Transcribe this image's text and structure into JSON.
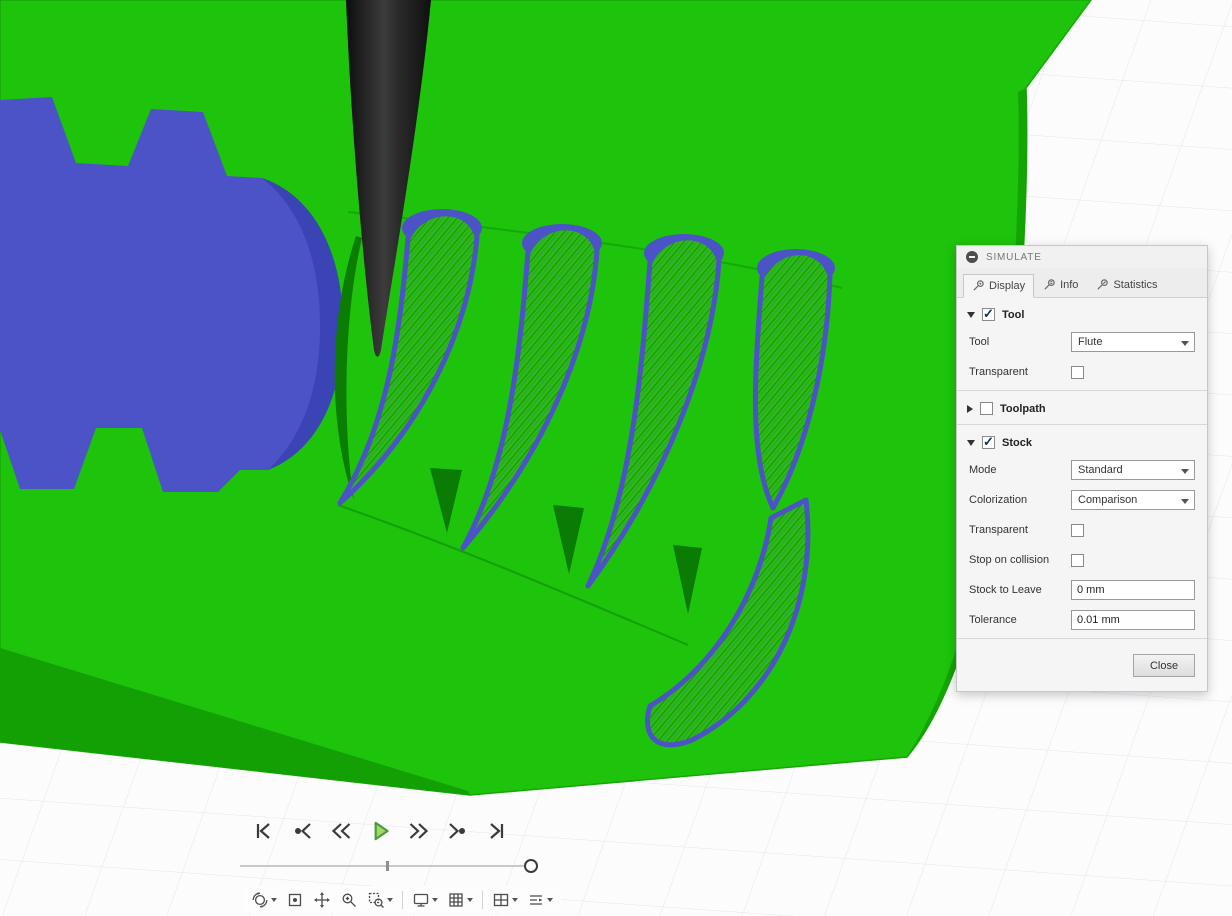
{
  "viewport": {
    "colors": {
      "stock_green": "#1ec30c",
      "stock_green_dark": "#12a004",
      "machined_blue": "#4b53c6",
      "tool_color": "#262626",
      "background": "#fcfcfd",
      "grid_line": "#e5e5ec",
      "play_button_green": "#a8d864"
    }
  },
  "panel": {
    "title": "SIMULATE",
    "tabs": [
      {
        "label": "Display",
        "active": true
      },
      {
        "label": "Info",
        "active": false
      },
      {
        "label": "Statistics",
        "active": false
      }
    ],
    "tool_section": {
      "label": "Tool",
      "enabled": true,
      "expanded": true,
      "tool_label": "Tool",
      "tool_value": "Flute",
      "transparent_label": "Transparent",
      "transparent_checked": false
    },
    "toolpath_section": {
      "label": "Toolpath",
      "enabled": false,
      "expanded": false
    },
    "stock_section": {
      "label": "Stock",
      "enabled": true,
      "expanded": true,
      "mode_label": "Mode",
      "mode_value": "Standard",
      "colorization_label": "Colorization",
      "colorization_value": "Comparison",
      "transparent_label": "Transparent",
      "transparent_checked": false,
      "stop_on_collision_label": "Stop on collision",
      "stop_on_collision_checked": false,
      "stock_to_leave_label": "Stock to Leave",
      "stock_to_leave_value": "0 mm",
      "tolerance_label": "Tolerance",
      "tolerance_value": "0.01 mm"
    },
    "close_label": "Close"
  },
  "playback": {
    "buttons": [
      "skip-to-start",
      "step-back",
      "rewind",
      "play",
      "fast-forward",
      "step-forward",
      "skip-to-end"
    ]
  },
  "nav_toolbar": {
    "items": [
      "orbit",
      "look-at",
      "pan",
      "zoom",
      "fit",
      "display-settings",
      "grid-and-snaps",
      "viewports",
      "steps"
    ]
  }
}
